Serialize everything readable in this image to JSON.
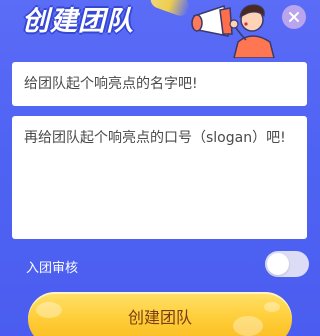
{
  "dialog": {
    "title": "创建团队"
  },
  "form": {
    "team_name_placeholder": "给团队起个响亮点的名字吧!",
    "slogan_placeholder": "再给团队起个响亮点的口号（slogan）吧!"
  },
  "review": {
    "label": "入团审核",
    "enabled": false
  },
  "buttons": {
    "create_label": "创建团队"
  },
  "icons": {
    "close": "close-icon",
    "mascot": "megaphone-person-icon",
    "sparkle": "sparkle-icon"
  },
  "colors": {
    "background": "#5b6cf6",
    "card": "#ffffff",
    "button": "#ffcf3c",
    "button_text": "#7a3e13",
    "close_bg": "#b9a4ee"
  }
}
